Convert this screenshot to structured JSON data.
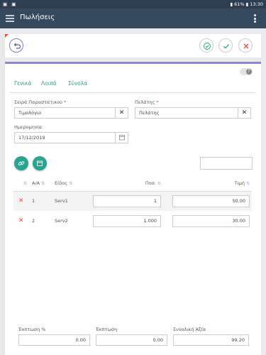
{
  "status": {
    "left_icons": "▣ ▣",
    "right": "▮ 61% ▮ 13:30"
  },
  "appbar": {
    "title": "Πωλήσεις"
  },
  "tabs": [
    "Γενικά",
    "Λοιπά",
    "Σύνολα"
  ],
  "help_icon": "?",
  "form": {
    "series_label": "Σειρά Παραστατικού",
    "series_value": "Τιμολόγιο",
    "customer_label": "Πελάτης",
    "customer_value": "Πελάτης",
    "date_label": "Ημερομηνία",
    "date_value": "17/12/2019",
    "required_mark": "*",
    "clear_glyph": "✕"
  },
  "table": {
    "headers": {
      "aa": "Α/Α",
      "item": "Είδος",
      "qty": "Ποσ.",
      "price": "Τιμή"
    },
    "sort_glyph": "⇅",
    "delete_glyph": "✕",
    "rows": [
      {
        "aa": "1",
        "item": "Serv1",
        "qty": "1",
        "price": "50.00"
      },
      {
        "aa": "2",
        "item": "Serv2",
        "qty": "1.000",
        "price": "30.00"
      }
    ]
  },
  "footer": {
    "discount_pct_label": "Έκπτωση %",
    "discount_pct_value": "0.00",
    "discount_label": "Έκπτωση",
    "discount_value": "0.00",
    "total_label": "Συνολική Αξία",
    "total_value": "99.20"
  },
  "colors": {
    "teal": "#2aa391",
    "appbar": "#34495e",
    "danger": "#e74c3c",
    "success": "#27ae60"
  }
}
